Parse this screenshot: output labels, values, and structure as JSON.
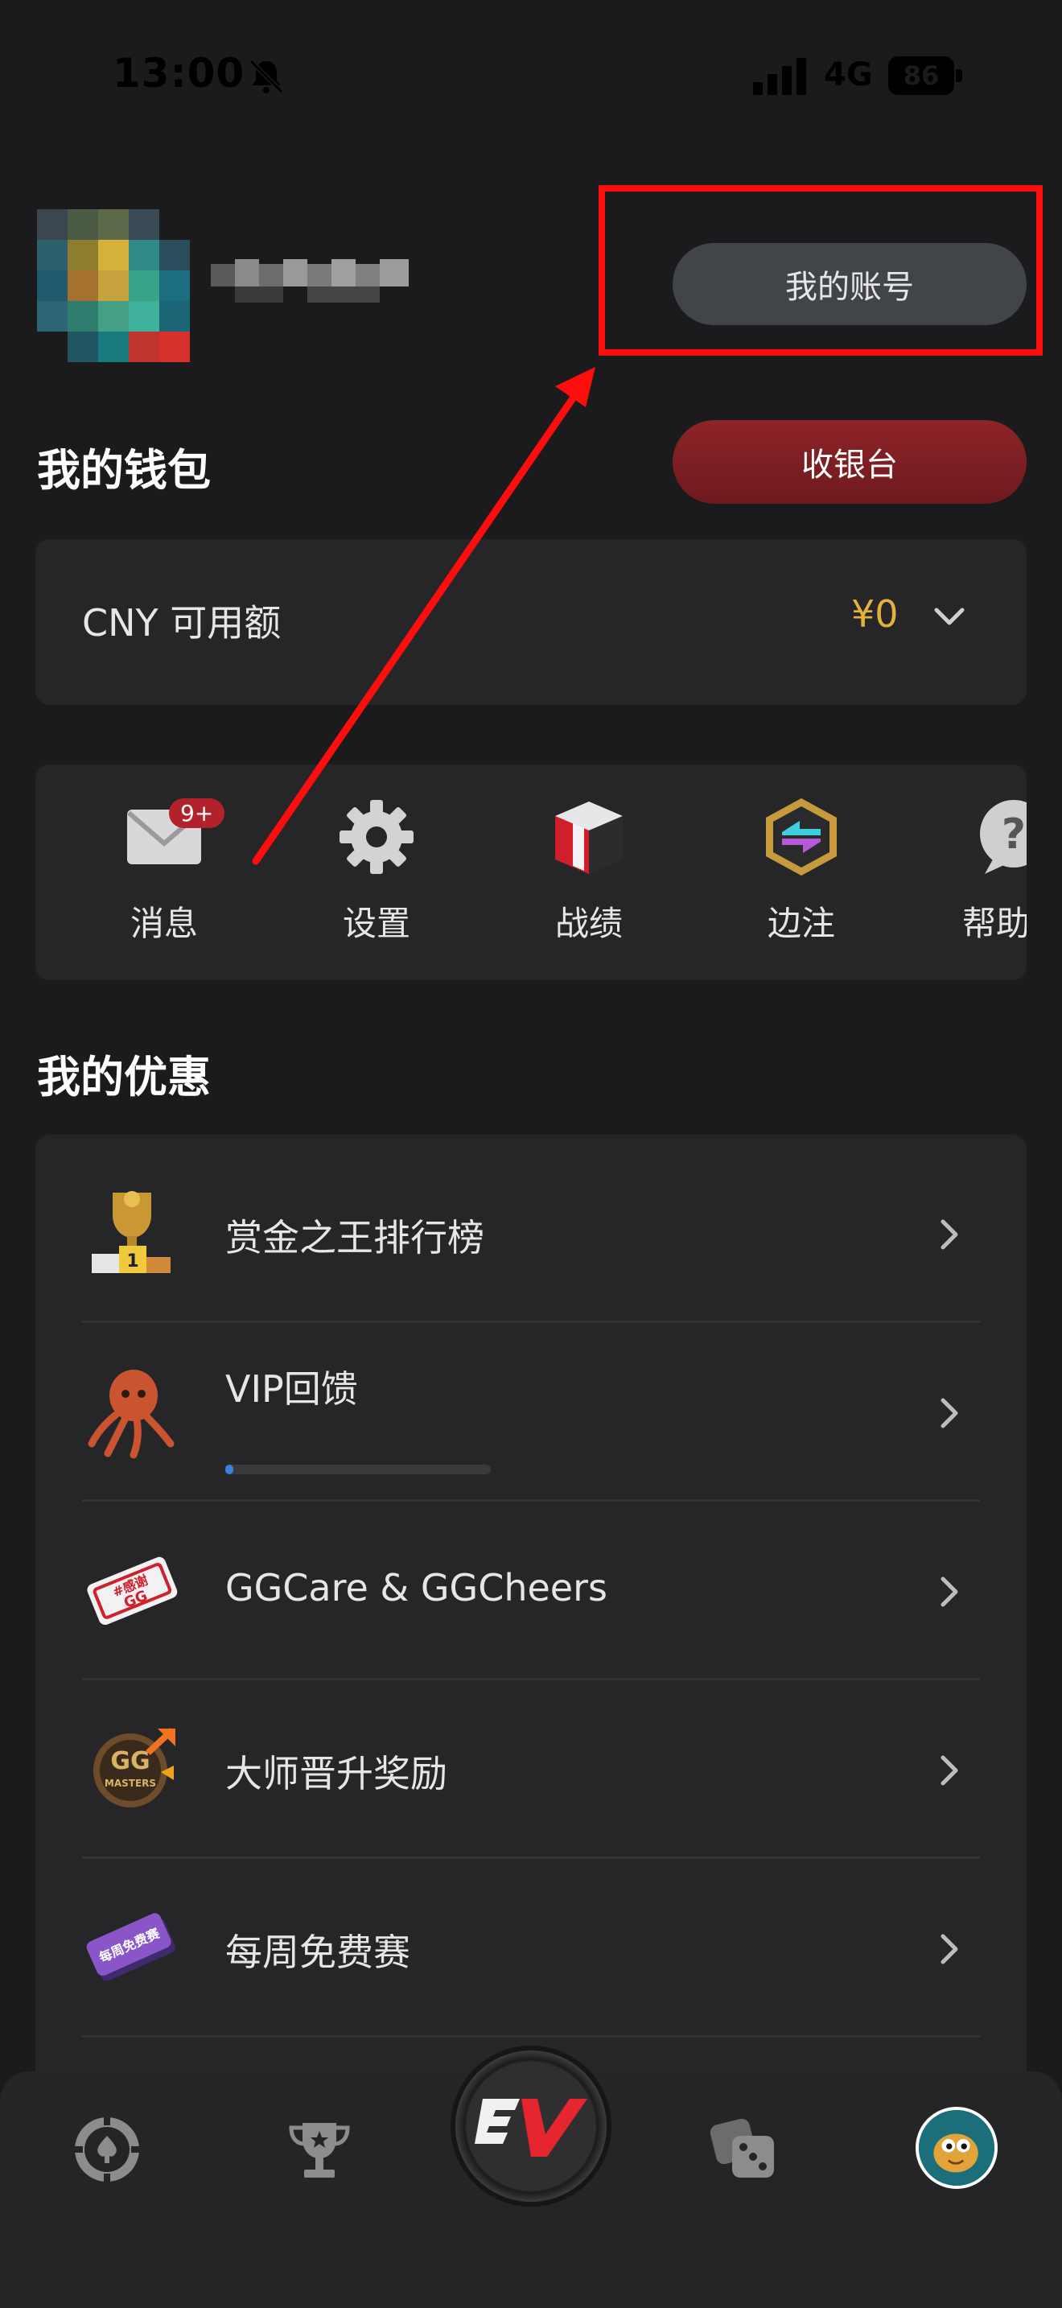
{
  "status_bar": {
    "time": "13:00",
    "network": "4G",
    "battery": "86"
  },
  "header": {
    "account_button": "我的账号"
  },
  "wallet": {
    "title": "我的钱包",
    "cashier_button": "收银台",
    "balance_label": "CNY 可用额",
    "balance_value": "¥0"
  },
  "quick_actions": {
    "badge": "9+",
    "items": [
      {
        "label": "消息",
        "icon": "mail-icon"
      },
      {
        "label": "设置",
        "icon": "gear-icon"
      },
      {
        "label": "战绩",
        "icon": "stats-cube-icon"
      },
      {
        "label": "边注",
        "icon": "side-bet-icon"
      },
      {
        "label": "帮助",
        "icon": "help-icon"
      }
    ]
  },
  "promotions": {
    "title": "我的优惠",
    "items": [
      {
        "label": "赏金之王排行榜",
        "icon": "trophy-icon"
      },
      {
        "label": "VIP回馈",
        "icon": "octopus-icon",
        "progress": 0.03
      },
      {
        "label": "GGCare & GGCheers",
        "icon": "ticket-icon"
      },
      {
        "label": "大师晋升奖励",
        "icon": "masters-badge-icon"
      },
      {
        "label": "每周免费赛",
        "icon": "free-ticket-icon"
      }
    ]
  },
  "bottom_nav": {
    "items": [
      "poker-chip-icon",
      "trophy-icon",
      "ev-logo-icon",
      "dice-icon",
      "profile-avatar"
    ]
  },
  "colors": {
    "accent_red": "#8d2428",
    "gold": "#e5b13b",
    "annotation_red": "#ff0d0d"
  }
}
